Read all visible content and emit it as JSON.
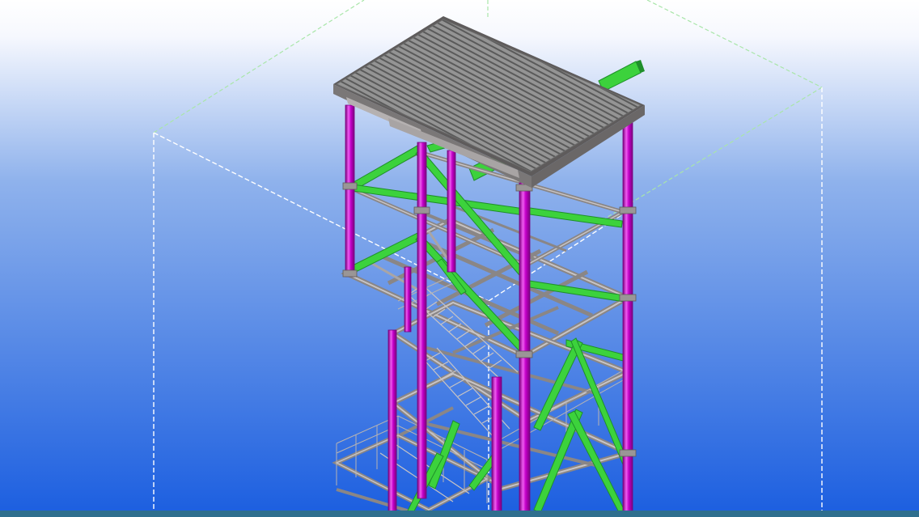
{
  "viewport": {
    "background_top": "#ffffff",
    "background_mid": "#8fb2ec",
    "background_bottom": "#1b5ee0",
    "bottom_strip_color": "#2f6f8e"
  },
  "colors": {
    "column": "#c300c8",
    "column_highlight": "#ef5cf0",
    "column_shadow": "#7a007e",
    "brace": "#3cd23c",
    "brace_highlight": "#8cf58c",
    "brace_shadow": "#1f8f2a",
    "beam": "#9a9696",
    "beam_light": "#c8c4c4",
    "beam_dark": "#5e5b5b",
    "roof": "#8e8e8e",
    "roof_rib": "#5a5a5a",
    "guide_line": "#a9e6a9",
    "work_area_line": "#ffffff"
  }
}
